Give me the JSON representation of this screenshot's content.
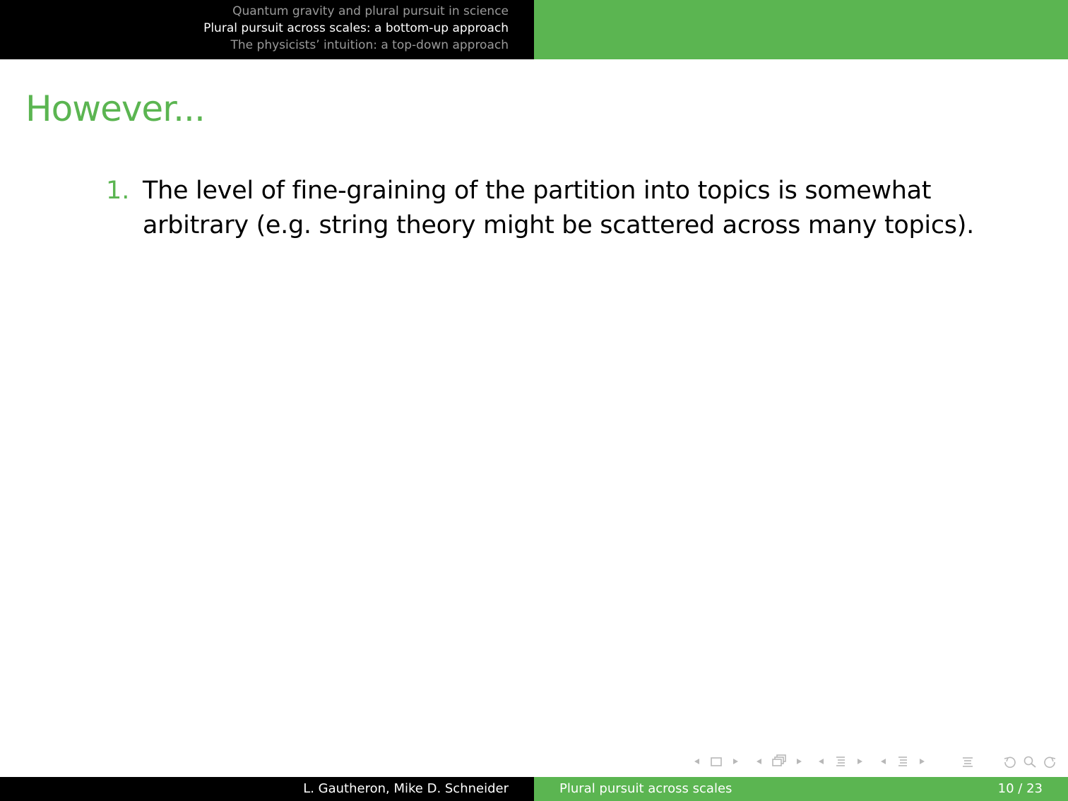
{
  "header": {
    "sections": [
      {
        "label": "Quantum gravity and plural pursuit in science",
        "current": false
      },
      {
        "label": "Plural pursuit across scales: a bottom-up approach",
        "current": true
      },
      {
        "label": "The physicists’ intuition: a top-down approach",
        "current": false
      }
    ]
  },
  "frame": {
    "title": "However...",
    "items": [
      {
        "number": "1.",
        "text": "The level of fine-graining of the partition into topics is somewhat arbitrary (e.g. string theory might be scattered across many topics)."
      }
    ]
  },
  "navigation": {
    "icons": [
      "prev-slide-icon",
      "slide-icon",
      "next-slide-icon",
      "prev-frame-icon",
      "frame-icon",
      "next-frame-icon",
      "prev-subsection-icon",
      "subsection-icon",
      "next-subsection-icon",
      "prev-section-icon",
      "section-icon",
      "next-section-icon",
      "align-icon",
      "undo-icon",
      "search-icon",
      "redo-icon"
    ],
    "color": "#b8b8b8"
  },
  "footer": {
    "authors": "L. Gautheron, Mike D. Schneider",
    "short_title": "Plural pursuit across scales",
    "page": "10 / 23"
  },
  "colors": {
    "accent": "#5bb551",
    "header_bg": "#000000",
    "inactive_section": "#9a9a9a"
  }
}
